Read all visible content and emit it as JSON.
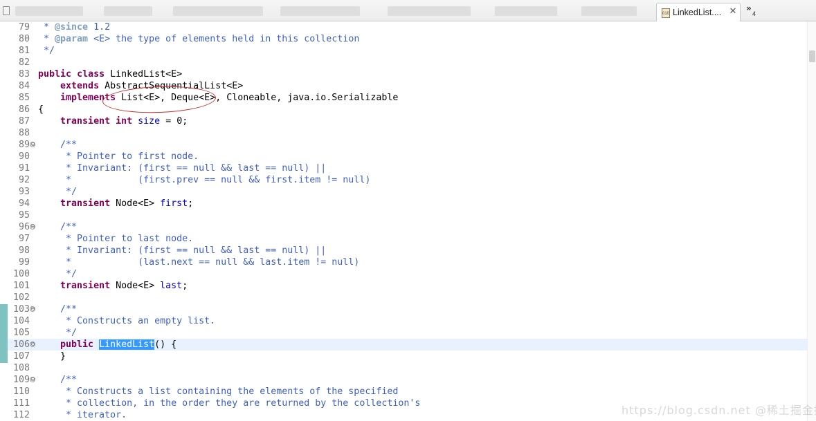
{
  "tabbar": {
    "active_tab": {
      "label": "LinkedList....",
      "icon_text": "010"
    },
    "close_glyph": "✕",
    "overflow_chevron": "»",
    "overflow_count": "4"
  },
  "editor": {
    "current_line": 106,
    "lines": [
      {
        "n": "79",
        "fold": false,
        "current": false,
        "parts": [
          {
            "t": " * ",
            "c": "cm"
          },
          {
            "t": "@since",
            "c": "tag"
          },
          {
            "t": " 1.2",
            "c": "cm"
          }
        ]
      },
      {
        "n": "80",
        "fold": false,
        "current": false,
        "parts": [
          {
            "t": " * ",
            "c": "cm"
          },
          {
            "t": "@param",
            "c": "tag"
          },
          {
            "t": " <E> the type of elements held in this collection",
            "c": "cm"
          }
        ]
      },
      {
        "n": "81",
        "fold": false,
        "current": false,
        "parts": [
          {
            "t": " */",
            "c": "cm"
          }
        ]
      },
      {
        "n": "82",
        "fold": false,
        "current": false,
        "parts": []
      },
      {
        "n": "83",
        "fold": false,
        "current": false,
        "parts": [
          {
            "t": "public",
            "c": "kw"
          },
          {
            "t": " ",
            "c": ""
          },
          {
            "t": "class",
            "c": "kw"
          },
          {
            "t": " LinkedList<E>",
            "c": ""
          }
        ]
      },
      {
        "n": "84",
        "fold": false,
        "current": false,
        "parts": [
          {
            "t": "    ",
            "c": ""
          },
          {
            "t": "extends",
            "c": "kw"
          },
          {
            "t": " AbstractSequentialList<E>",
            "c": ""
          }
        ]
      },
      {
        "n": "85",
        "fold": false,
        "current": false,
        "parts": [
          {
            "t": "    ",
            "c": ""
          },
          {
            "t": "implements",
            "c": "kw"
          },
          {
            "t": " List<E>, Deque<E>, Cloneable, java.io.Serializable",
            "c": ""
          }
        ]
      },
      {
        "n": "86",
        "fold": false,
        "current": false,
        "parts": [
          {
            "t": "{",
            "c": ""
          }
        ]
      },
      {
        "n": "87",
        "fold": false,
        "current": false,
        "parts": [
          {
            "t": "    ",
            "c": ""
          },
          {
            "t": "transient",
            "c": "kw"
          },
          {
            "t": " ",
            "c": ""
          },
          {
            "t": "int",
            "c": "kw"
          },
          {
            "t": " ",
            "c": ""
          },
          {
            "t": "size",
            "c": "fld"
          },
          {
            "t": " = 0;",
            "c": ""
          }
        ]
      },
      {
        "n": "88",
        "fold": false,
        "current": false,
        "parts": []
      },
      {
        "n": "89",
        "fold": true,
        "current": false,
        "parts": [
          {
            "t": "    /**",
            "c": "cm"
          }
        ]
      },
      {
        "n": "90",
        "fold": false,
        "current": false,
        "parts": [
          {
            "t": "     * Pointer to first node.",
            "c": "cm"
          }
        ]
      },
      {
        "n": "91",
        "fold": false,
        "current": false,
        "parts": [
          {
            "t": "     * Invariant: (first == null && last == null) ||",
            "c": "cm"
          }
        ]
      },
      {
        "n": "92",
        "fold": false,
        "current": false,
        "parts": [
          {
            "t": "     *            (first.prev == null && first.item != null)",
            "c": "cm"
          }
        ]
      },
      {
        "n": "93",
        "fold": false,
        "current": false,
        "parts": [
          {
            "t": "     */",
            "c": "cm"
          }
        ]
      },
      {
        "n": "94",
        "fold": false,
        "current": false,
        "parts": [
          {
            "t": "    ",
            "c": ""
          },
          {
            "t": "transient",
            "c": "kw"
          },
          {
            "t": " Node<E> ",
            "c": ""
          },
          {
            "t": "first",
            "c": "fld"
          },
          {
            "t": ";",
            "c": ""
          }
        ]
      },
      {
        "n": "95",
        "fold": false,
        "current": false,
        "parts": []
      },
      {
        "n": "96",
        "fold": true,
        "current": false,
        "parts": [
          {
            "t": "    /**",
            "c": "cm"
          }
        ]
      },
      {
        "n": "97",
        "fold": false,
        "current": false,
        "parts": [
          {
            "t": "     * Pointer to last node.",
            "c": "cm"
          }
        ]
      },
      {
        "n": "98",
        "fold": false,
        "current": false,
        "parts": [
          {
            "t": "     * Invariant: (first == null && last == null) ||",
            "c": "cm"
          }
        ]
      },
      {
        "n": "99",
        "fold": false,
        "current": false,
        "parts": [
          {
            "t": "     *            (last.next == null && last.item != null)",
            "c": "cm"
          }
        ]
      },
      {
        "n": "100",
        "fold": false,
        "current": false,
        "parts": [
          {
            "t": "     */",
            "c": "cm"
          }
        ]
      },
      {
        "n": "101",
        "fold": false,
        "current": false,
        "parts": [
          {
            "t": "    ",
            "c": ""
          },
          {
            "t": "transient",
            "c": "kw"
          },
          {
            "t": " Node<E> ",
            "c": ""
          },
          {
            "t": "last",
            "c": "fld"
          },
          {
            "t": ";",
            "c": ""
          }
        ]
      },
      {
        "n": "102",
        "fold": false,
        "current": false,
        "parts": []
      },
      {
        "n": "103",
        "fold": true,
        "current": false,
        "parts": [
          {
            "t": "    /**",
            "c": "cm"
          }
        ]
      },
      {
        "n": "104",
        "fold": false,
        "current": false,
        "parts": [
          {
            "t": "     * Constructs an empty list.",
            "c": "cm"
          }
        ]
      },
      {
        "n": "105",
        "fold": false,
        "current": false,
        "parts": [
          {
            "t": "     */",
            "c": "cm"
          }
        ]
      },
      {
        "n": "106",
        "fold": true,
        "current": true,
        "parts": [
          {
            "t": "    ",
            "c": ""
          },
          {
            "t": "public",
            "c": "kw"
          },
          {
            "t": " ",
            "c": ""
          },
          {
            "t": "LinkedList",
            "c": "sel"
          },
          {
            "t": "() {",
            "c": ""
          }
        ]
      },
      {
        "n": "107",
        "fold": false,
        "current": false,
        "parts": [
          {
            "t": "    }",
            "c": ""
          }
        ]
      },
      {
        "n": "108",
        "fold": false,
        "current": false,
        "parts": []
      },
      {
        "n": "109",
        "fold": true,
        "current": false,
        "parts": [
          {
            "t": "    /**",
            "c": "cm"
          }
        ]
      },
      {
        "n": "110",
        "fold": false,
        "current": false,
        "parts": [
          {
            "t": "     * Constructs a list containing the elements of the specified",
            "c": "cm"
          }
        ]
      },
      {
        "n": "111",
        "fold": false,
        "current": false,
        "parts": [
          {
            "t": "     * collection, in the order they are returned by the collection's",
            "c": "cm"
          }
        ]
      },
      {
        "n": "112",
        "fold": false,
        "current": false,
        "parts": [
          {
            "t": "     * iterator.",
            "c": "cm"
          }
        ]
      }
    ]
  },
  "fold_glyph": "⊖",
  "watermark": "https://blog.csdn.net @稀土掘金技术社区",
  "colors": {
    "keyword": "#7f0055",
    "comment": "#3f5fbf",
    "javadoc_tag": "#7f9fbf",
    "field": "#0000c0",
    "selection": "#3399ff",
    "current_line": "#e8f2fe",
    "annotation_circle": "#cc2a2a",
    "change_marker": "#7ec3c1"
  }
}
